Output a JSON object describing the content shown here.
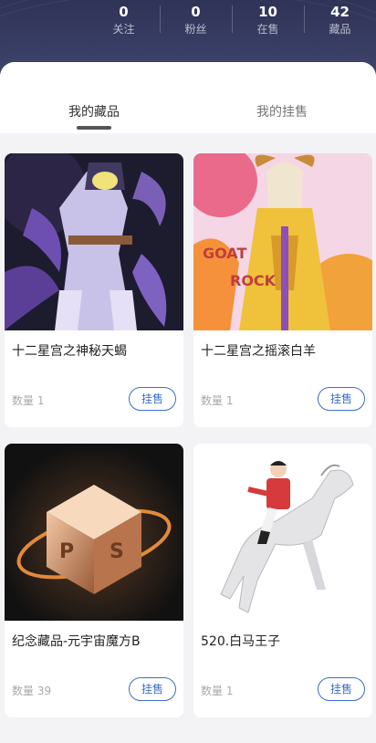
{
  "stats": [
    {
      "value": "0",
      "label": "关注"
    },
    {
      "value": "0",
      "label": "粉丝"
    },
    {
      "value": "10",
      "label": "在售"
    },
    {
      "value": "42",
      "label": "藏品"
    }
  ],
  "tabs": [
    {
      "label": "我的藏品",
      "active": true
    },
    {
      "label": "我的挂售",
      "active": false
    }
  ],
  "items": [
    {
      "name": "十二星宫之神秘天蝎",
      "qty": "数量 1",
      "action": "挂售",
      "image": "scorpio-artwork"
    },
    {
      "name": "十二星宫之摇滚白羊",
      "qty": "数量 1",
      "action": "挂售",
      "image": "aries-rock-artwork"
    },
    {
      "name": "纪念藏品-元宇宙魔方B",
      "qty": "数量 39",
      "action": "挂售",
      "image": "metaverse-cube-artwork"
    },
    {
      "name": "520.白马王子",
      "qty": "数量 1",
      "action": "挂售",
      "image": "white-horse-artwork"
    }
  ]
}
